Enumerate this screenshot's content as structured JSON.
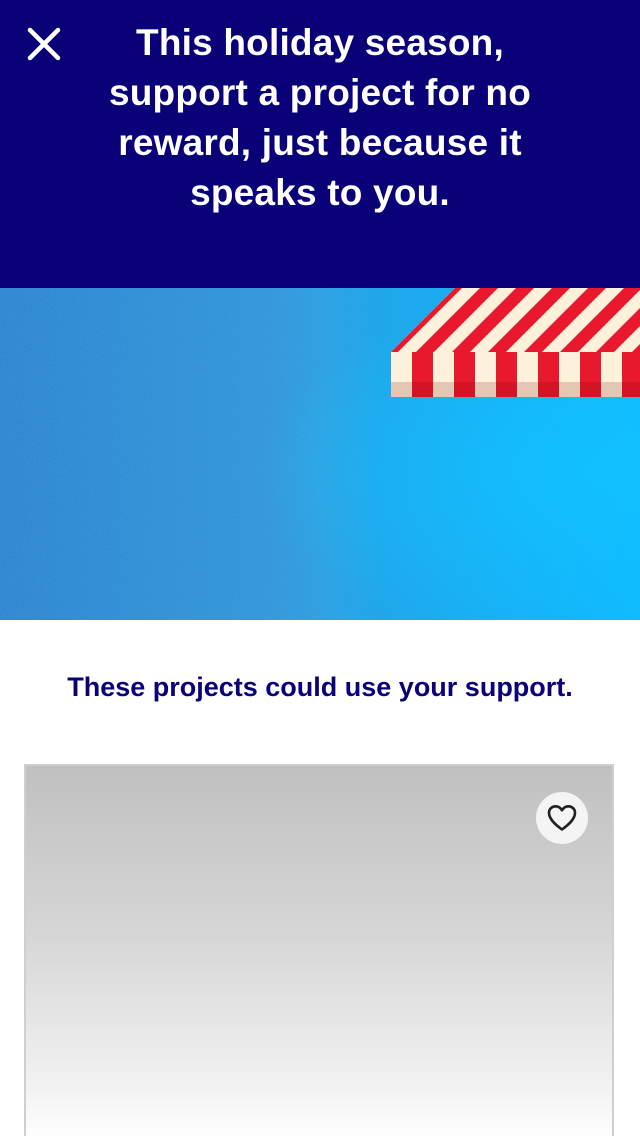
{
  "banner": {
    "headline": "This holiday season, support a project for no reward, just because it speaks to you.",
    "close_icon": "close-icon",
    "background_color": "#0a0178"
  },
  "hero": {
    "illustration": "shop-awning-illustration",
    "colors": {
      "sky_left": "#1f7fcf",
      "sky_right": "#0fbaff",
      "stripe_red": "#e8192c",
      "stripe_cream": "#fdf1dc"
    }
  },
  "section": {
    "heading": "These projects could use your support."
  },
  "project_card": {
    "favorite_icon": "heart-outline-icon"
  }
}
